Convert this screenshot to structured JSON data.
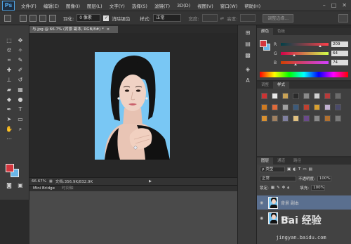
{
  "app": {
    "logo": "Ps"
  },
  "menu": {
    "items": [
      "文件(F)",
      "编辑(E)",
      "图像(I)",
      "图层(L)",
      "文字(Y)",
      "选择(S)",
      "滤镜(T)",
      "3D(D)",
      "视图(V)",
      "窗口(W)",
      "帮助(H)"
    ]
  },
  "window_controls": {
    "min": "–",
    "max": "□",
    "close": "✕"
  },
  "options": {
    "feather_label": "羽化:",
    "feather_value": "0 像素",
    "antialias_label": "消除锯齿",
    "antialias_checked": "✓",
    "style_label": "样式:",
    "style_value": "正常",
    "width_label": "宽度:",
    "height_label": "高度:",
    "refine_label": "调整边缘..."
  },
  "document": {
    "tab_title": "与.jpg @ 66.7% (背景 副本, RGB/8#) *",
    "tab_close": "×",
    "zoom": "66.67%",
    "doc_size": "文档:356.9K/832.9K",
    "status_arrow": "▶"
  },
  "mini_bridge": {
    "tabs": [
      "Mini Bridge",
      "时间轴"
    ]
  },
  "color_panel": {
    "tabs": [
      "颜色",
      "色板"
    ],
    "fg_color": "#d4363e",
    "bg_color": "#6ab7e8",
    "channels": [
      {
        "label": "R",
        "value": "209",
        "fraction": 0.82
      },
      {
        "label": "G",
        "value": "64",
        "fraction": 0.25
      },
      {
        "label": "B",
        "value": "74",
        "fraction": 0.29
      }
    ]
  },
  "styles_panel": {
    "tabs": [
      "调整",
      "样式"
    ]
  },
  "layers_panel": {
    "tabs": [
      "图层",
      "通道",
      "路径"
    ],
    "filter": "ρ 类型",
    "blend_mode": "正常",
    "opacity_label": "不透明度:",
    "opacity_value": "100%",
    "lock_label": "锁定:",
    "fill_label": "填充:",
    "fill_value": "100%",
    "layers": [
      {
        "name": "背景 副本",
        "selected": true
      },
      {
        "name": "背景",
        "selected": false
      }
    ]
  },
  "watermark": {
    "text": "Bai 经验",
    "url": "jingyan.baidu.com"
  },
  "icons": [
    "marquee-icon",
    "move-icon",
    "lasso-icon",
    "magic-wand-icon",
    "crop-icon",
    "eyedropper-icon",
    "healing-icon",
    "brush-icon",
    "stamp-icon",
    "history-brush-icon",
    "eraser-icon",
    "gradient-icon",
    "blur-icon",
    "dodge-icon",
    "pen-icon",
    "type-icon",
    "path-select-icon",
    "shape-icon",
    "hand-icon",
    "zoom-icon",
    "eye-icon"
  ]
}
